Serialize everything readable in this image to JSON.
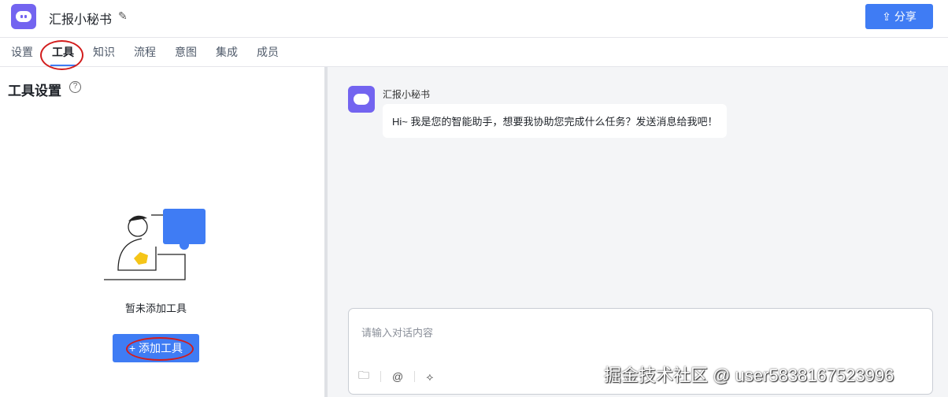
{
  "header": {
    "title": "汇报小秘书",
    "share_label": "分享"
  },
  "tabs": [
    {
      "label": "设置"
    },
    {
      "label": "工具"
    },
    {
      "label": "知识"
    },
    {
      "label": "流程"
    },
    {
      "label": "意图"
    },
    {
      "label": "集成"
    },
    {
      "label": "成员"
    }
  ],
  "active_tab": "工具",
  "left": {
    "heading": "工具设置",
    "empty_text": "暂未添加工具",
    "add_label": "+ 添加工具"
  },
  "chat": {
    "bot_name": "汇报小秘书",
    "greeting": "Hi~ 我是您的智能助手，想要我协助您完成什么任务？发送消息给我吧！",
    "input_placeholder": "请输入对话内容"
  },
  "watermark": "掘金技术社区 @ user5838167523996",
  "colors": {
    "accent": "#3f7cf4",
    "brand": "#7364f0"
  }
}
